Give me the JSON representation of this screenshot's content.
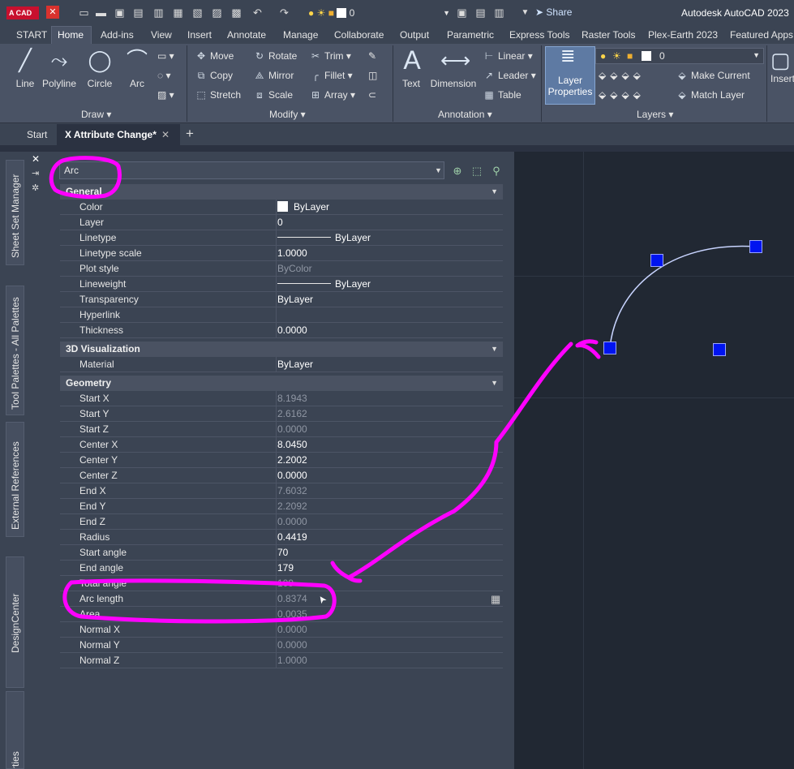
{
  "titlebar": {
    "logo_text": "A CAD",
    "layer_value": "0",
    "share_label": "Share",
    "app_title": "Autodesk AutoCAD 2023"
  },
  "ribbon_tabs": [
    "START",
    "Home",
    "Add-ins",
    "View",
    "Insert",
    "Annotate",
    "Manage",
    "Collaborate",
    "Output",
    "Parametric",
    "Express Tools",
    "Raster Tools",
    "Plex-Earth 2023",
    "Featured Apps"
  ],
  "ribbon": {
    "draw": {
      "line": "Line",
      "polyline": "Polyline",
      "circle": "Circle",
      "arc": "Arc",
      "panel": "Draw ▾"
    },
    "modify": {
      "move": "Move",
      "rotate": "Rotate",
      "trim": "Trim",
      "copy": "Copy",
      "mirror": "Mirror",
      "fillet": "Fillet",
      "stretch": "Stretch",
      "scale": "Scale",
      "array": "Array",
      "panel": "Modify ▾"
    },
    "annotation": {
      "text": "Text",
      "dimension": "Dimension",
      "linear": "Linear",
      "leader": "Leader",
      "table": "Table",
      "panel": "Annotation ▾"
    },
    "layers": {
      "layer_properties_1": "Layer",
      "layer_properties_2": "Properties",
      "layer_value": "0",
      "make_current": "Make Current",
      "match_layer": "Match Layer",
      "panel": "Layers ▾"
    },
    "insert_label": "Insert"
  },
  "filetabs": {
    "start": "Start",
    "active": "X Attribute Change*"
  },
  "side_tabs": {
    "sheet_set": "Sheet Set Manager",
    "tool_palettes": "Tool Palettes - All Palettes",
    "xrefs": "External References",
    "design_center": "DesignCenter",
    "properties": "Properties"
  },
  "properties": {
    "object_type": "Arc",
    "general": {
      "title": "General",
      "rows": [
        {
          "name": "Color",
          "value": "ByLayer"
        },
        {
          "name": "Layer",
          "value": "0"
        },
        {
          "name": "Linetype",
          "value": "ByLayer"
        },
        {
          "name": "Linetype scale",
          "value": "1.0000"
        },
        {
          "name": "Plot style",
          "value": "ByColor"
        },
        {
          "name": "Lineweight",
          "value": "ByLayer"
        },
        {
          "name": "Transparency",
          "value": "ByLayer"
        },
        {
          "name": "Hyperlink",
          "value": ""
        },
        {
          "name": "Thickness",
          "value": "0.0000"
        }
      ]
    },
    "viz": {
      "title": "3D Visualization",
      "rows": [
        {
          "name": "Material",
          "value": "ByLayer"
        }
      ]
    },
    "geometry": {
      "title": "Geometry",
      "rows": [
        {
          "name": "Start X",
          "value": "8.1943"
        },
        {
          "name": "Start Y",
          "value": "2.6162"
        },
        {
          "name": "Start Z",
          "value": "0.0000"
        },
        {
          "name": "Center X",
          "value": "8.0450"
        },
        {
          "name": "Center Y",
          "value": "2.2002"
        },
        {
          "name": "Center Z",
          "value": "0.0000"
        },
        {
          "name": "End X",
          "value": "7.6032"
        },
        {
          "name": "End Y",
          "value": "2.2092"
        },
        {
          "name": "End Z",
          "value": "0.0000"
        },
        {
          "name": "Radius",
          "value": "0.4419"
        },
        {
          "name": "Start angle",
          "value": "70"
        },
        {
          "name": "End angle",
          "value": "179"
        },
        {
          "name": "Total angle",
          "value": "109"
        },
        {
          "name": "Arc length",
          "value": "0.8374"
        },
        {
          "name": "Area",
          "value": "0.0035"
        },
        {
          "name": "Normal X",
          "value": "0.0000"
        },
        {
          "name": "Normal Y",
          "value": "0.0000"
        },
        {
          "name": "Normal Z",
          "value": "1.0000"
        }
      ]
    }
  },
  "colors": {
    "annotation": "#ff00ff",
    "grip": "#0014f0",
    "canvas": "#212833"
  }
}
